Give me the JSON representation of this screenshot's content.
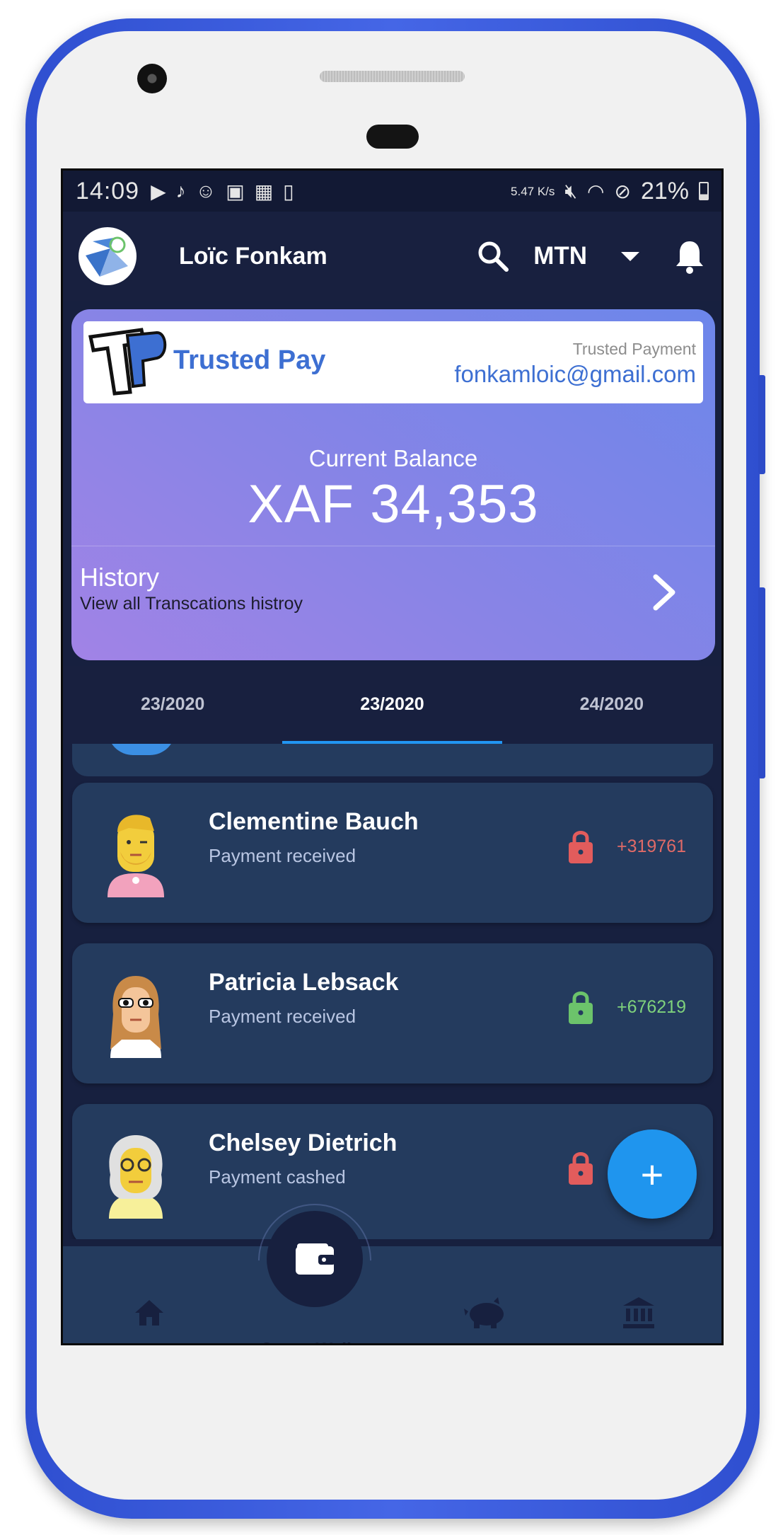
{
  "status_bar": {
    "time": "14:09",
    "network_speed": "5.47 K/s",
    "battery": "21%"
  },
  "header": {
    "user_name": "Loïc Fonkam",
    "carrier": "MTN"
  },
  "balance_card": {
    "brand_name": "Trusted Pay",
    "brand_sub": "Trusted Payment",
    "email": "fonkamloic@gmail.com",
    "balance_label": "Current Balance",
    "balance_value": "XAF 34,353",
    "history_title": "History",
    "history_sub": "View all Transcations histroy"
  },
  "tabs": [
    {
      "label": "23/2020",
      "active": false
    },
    {
      "label": "23/2020",
      "active": true
    },
    {
      "label": "24/2020",
      "active": false
    }
  ],
  "transactions": [
    {
      "name": "Clementine Bauch",
      "status": "Payment received",
      "amount": "+319761",
      "lock_color": "#e25c5c",
      "amount_color": "#e06a67"
    },
    {
      "name": "Patricia Lebsack",
      "status": "Payment received",
      "amount": "+676219",
      "lock_color": "#6cc36b",
      "amount_color": "#7fd27c"
    },
    {
      "name": "Chelsey Dietrich",
      "status": "Payment cashed",
      "amount": "",
      "lock_color": "#e25c5c",
      "amount_color": "#e06a67"
    }
  ],
  "bottom_nav": {
    "wallet_label": "Smart Wallet"
  },
  "fab": {
    "label": "+"
  },
  "colors": {
    "background": "#17203f",
    "card_surface": "#243b5e",
    "accent": "#1f95ee"
  }
}
